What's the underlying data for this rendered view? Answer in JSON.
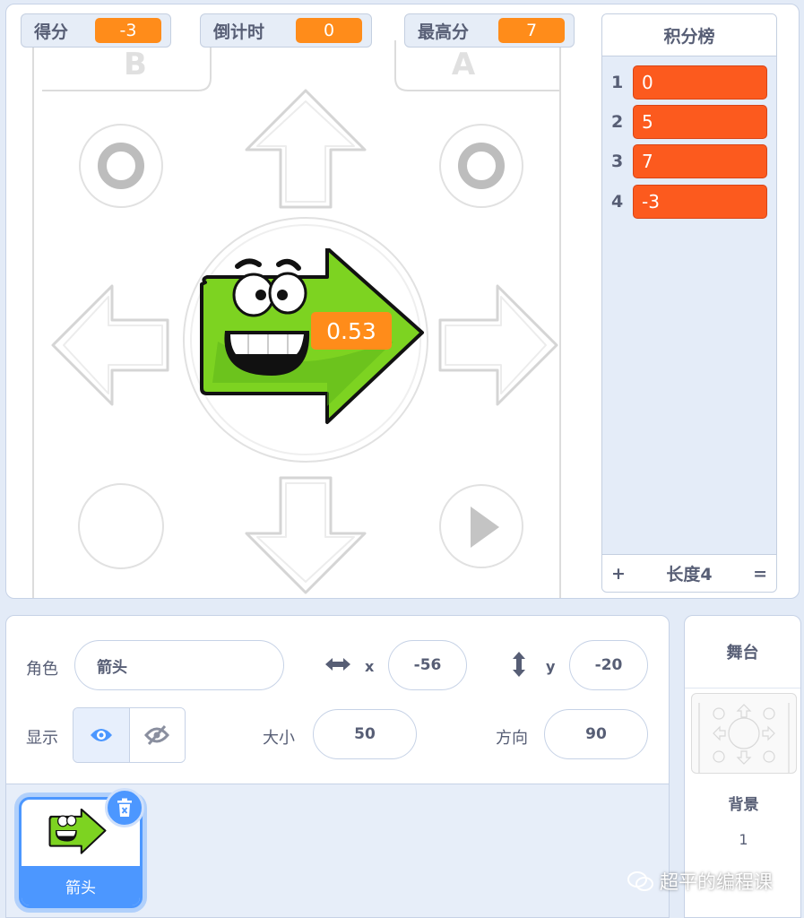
{
  "monitors": [
    {
      "label": "得分",
      "value": "-3"
    },
    {
      "label": "倒计时",
      "value": "0"
    },
    {
      "label": "最高分",
      "value": "7"
    }
  ],
  "leaderboard": {
    "title": "积分榜",
    "items": [
      {
        "index": "1",
        "value": "0"
      },
      {
        "index": "2",
        "value": "5"
      },
      {
        "index": "3",
        "value": "7"
      },
      {
        "index": "4",
        "value": "-3"
      }
    ],
    "add_label": "+",
    "length_label": "长度4",
    "resize_label": "="
  },
  "stage_backdrop": {
    "button_labels": [
      "B",
      "A"
    ],
    "speech_value": "0.53"
  },
  "sprite_info": {
    "sprite_label": "角色",
    "sprite_name": "箭头",
    "x_label": "x",
    "x_value": "-56",
    "y_label": "y",
    "y_value": "-20",
    "show_label": "显示",
    "size_label": "大小",
    "size_value": "50",
    "direction_label": "方向",
    "direction_value": "90"
  },
  "sprite_list": {
    "items": [
      {
        "name": "箭头"
      }
    ]
  },
  "stage_panel": {
    "title": "舞台",
    "backdrop_label": "背景",
    "backdrop_count": "1"
  },
  "watermark": "超平的编程课",
  "colors": {
    "accent_blue": "#4c97ff",
    "monitor_orange": "#ff8c1a",
    "list_cell_red": "#fc5a1e",
    "arrow_green": "#7dd321"
  }
}
